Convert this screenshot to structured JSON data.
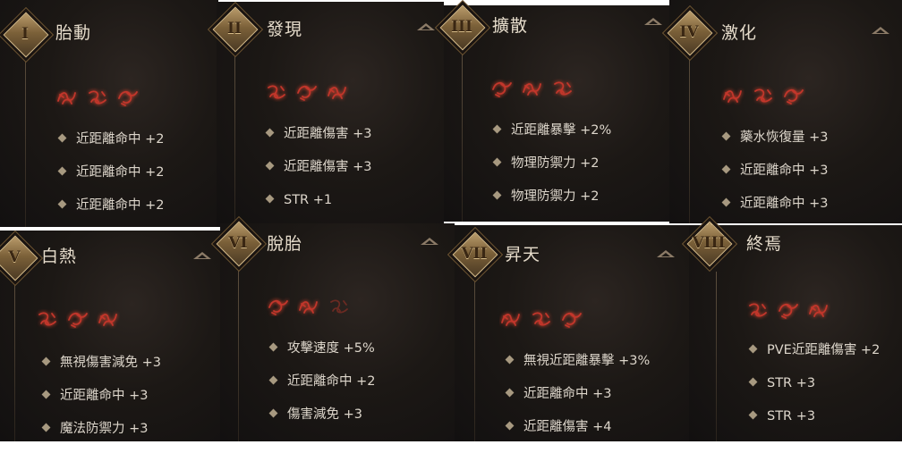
{
  "panels": [
    {
      "numeral": "I",
      "title": "胎動",
      "stats": [
        "近距離命中 +2",
        "近距離命中 +2",
        "近距離命中 +2"
      ]
    },
    {
      "numeral": "II",
      "title": "發現",
      "stats": [
        "近距離傷害 +3",
        "近距離傷害 +3",
        "STR +1"
      ]
    },
    {
      "numeral": "III",
      "title": "擴散",
      "stats": [
        "近距離暴擊 +2%",
        "物理防禦力 +2",
        "物理防禦力 +2"
      ]
    },
    {
      "numeral": "IV",
      "title": "激化",
      "stats": [
        "藥水恢復量 +3",
        "近距離命中 +3",
        "近距離命中 +3"
      ]
    },
    {
      "numeral": "V",
      "title": "白熱",
      "stats": [
        "無視傷害減免 +3",
        "近距離命中 +3",
        "魔法防禦力 +3"
      ]
    },
    {
      "numeral": "VI",
      "title": "脫胎",
      "stats": [
        "攻擊速度 +5%",
        "近距離命中 +2",
        "傷害減免 +3"
      ]
    },
    {
      "numeral": "VII",
      "title": "昇天",
      "stats": [
        "無視近距離暴擊 +3%",
        "近距離命中 +3",
        "近距離傷害 +4"
      ]
    },
    {
      "numeral": "VIII",
      "title": "終焉",
      "stats": [
        "PVE近距離傷害 +2",
        "STR +3",
        "STR +3"
      ]
    }
  ],
  "colors": {
    "rune": "#c2362b",
    "title": "#e6dccb",
    "stat": "#ddd6cb",
    "emblem": "#b89a6a"
  },
  "icons": {
    "emblem": "diamond-badge-icon",
    "rune": "red-rune-icon",
    "collapse": "chevron-up-icon",
    "bullet": "diamond-bullet-icon"
  }
}
